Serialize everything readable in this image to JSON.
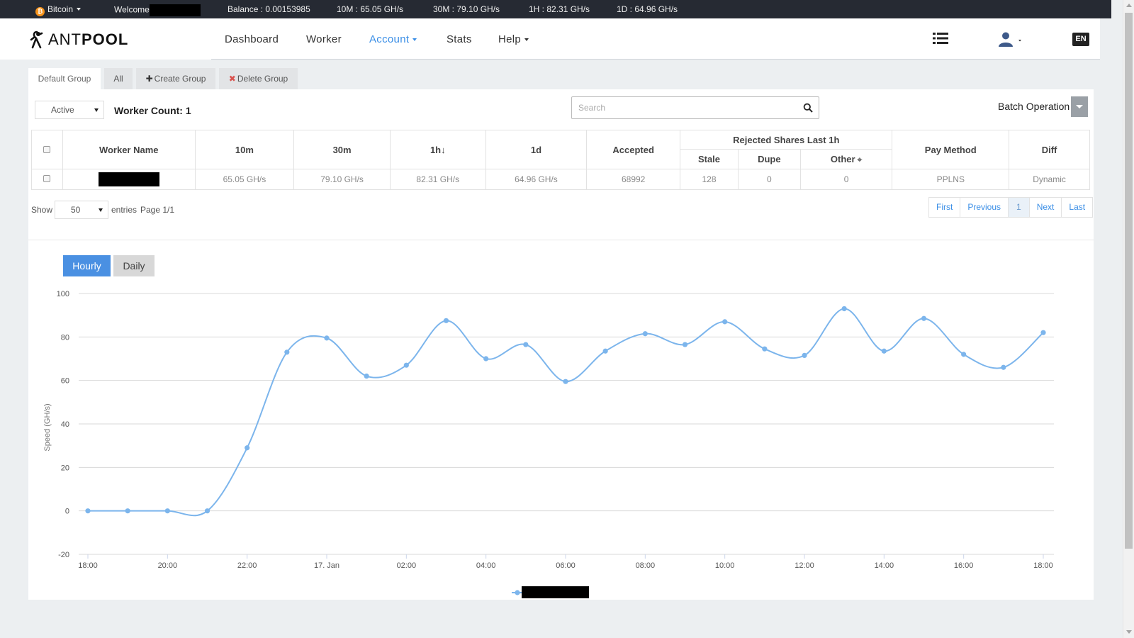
{
  "topbar": {
    "coin": "Bitcoin",
    "coin_icon": "bitcoin-icon",
    "welcome": "Welcome",
    "balance": "Balance : 0.00153985",
    "hash_10m": "10M : 65.05 GH/s",
    "hash_30m": "30M : 79.10 GH/s",
    "hash_1h": "1H : 82.31 GH/s",
    "hash_1d": "1D : 64.96 GH/s"
  },
  "nav": {
    "logo_thin": "ANT",
    "logo_bold": "POOL",
    "items": [
      "Dashboard",
      "Worker",
      "Account",
      "Stats",
      "Help"
    ],
    "active_item": "Account",
    "language": "EN",
    "accent_color": "#3a8ee6"
  },
  "group_tabs": {
    "default": "Default Group",
    "all": "All",
    "create": "Create Group",
    "delete": "Delete Group"
  },
  "filters": {
    "status": "Active",
    "worker_count": "Worker Count: 1",
    "search_placeholder": "Search",
    "batch_operation": "Batch Operation"
  },
  "table": {
    "headers": {
      "worker_name": "Worker Name",
      "h10m": "10m",
      "h30m": "30m",
      "h1h": "1h",
      "sort_arrow": "↓",
      "h1d": "1d",
      "accepted": "Accepted",
      "rejected_group": "Rejected Shares Last 1h",
      "stale": "Stale",
      "dupe": "Dupe",
      "other": "Other",
      "other_icon": "⌖",
      "pay_method": "Pay Method",
      "diff": "Diff"
    },
    "rows": [
      {
        "h10m": "65.05 GH/s",
        "h30m": "79.10 GH/s",
        "h1h": "82.31 GH/s",
        "h1d": "64.96 GH/s",
        "accepted": "68992",
        "stale": "128",
        "dupe": "0",
        "other": "0",
        "pay_method": "PPLNS",
        "diff": "Dynamic"
      }
    ]
  },
  "pagination": {
    "show": "Show",
    "entries_value": "50",
    "entries": "entries",
    "page": "Page 1/1",
    "first": "First",
    "previous": "Previous",
    "current": "1",
    "next": "Next",
    "last": "Last"
  },
  "chart_tabs": {
    "hourly": "Hourly",
    "daily": "Daily",
    "active": "Hourly"
  },
  "chart_data": {
    "type": "line",
    "ylabel": "Speed (GH/s)",
    "ylim": [
      -20,
      100
    ],
    "yticks": [
      -20,
      0,
      20,
      40,
      60,
      80,
      100
    ],
    "xticks": [
      "18:00",
      "20:00",
      "22:00",
      "17. Jan",
      "02:00",
      "04:00",
      "06:00",
      "08:00",
      "10:00",
      "12:00",
      "14:00",
      "16:00",
      "18:00"
    ],
    "x": [
      "18:00",
      "19:00",
      "20:00",
      "21:00",
      "22:00",
      "23:00",
      "17. Jan",
      "01:00",
      "02:00",
      "03:00",
      "04:00",
      "05:00",
      "06:00",
      "07:00",
      "08:00",
      "09:00",
      "10:00",
      "11:00",
      "12:00",
      "13:00",
      "14:00",
      "15:00",
      "16:00",
      "17:00",
      "18:00"
    ],
    "series": [
      {
        "values": [
          0,
          0,
          0,
          0,
          29,
          73,
          79.5,
          62,
          67,
          87.5,
          70,
          76.5,
          59.5,
          73.5,
          81.5,
          76.5,
          87,
          74.5,
          71.5,
          93,
          73.5,
          88.5,
          72,
          66,
          82
        ],
        "color": "#7cb5ec"
      }
    ],
    "grid": true,
    "legend_position": "bottom-center"
  }
}
